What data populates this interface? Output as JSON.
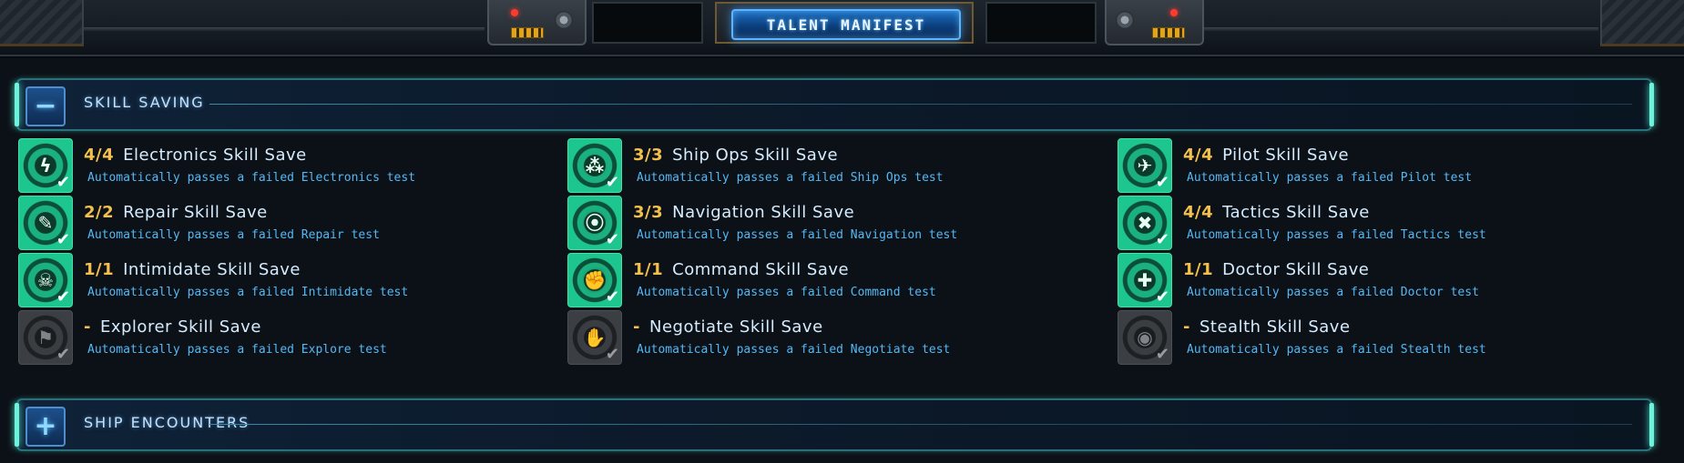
{
  "header": {
    "title": "TALENT MANIFEST"
  },
  "sections": [
    {
      "title": "SKILL SAVING",
      "toggle": "−",
      "expanded": true
    },
    {
      "title": "SHIP ENCOUNTERS",
      "toggle": "+",
      "expanded": false
    }
  ],
  "skills": [
    {
      "count": "4/4",
      "name": "Electronics Skill Save",
      "desc": "Automatically passes a failed Electronics test",
      "icon": "electronics-icon",
      "glyph": "ϟ",
      "unlocked": true
    },
    {
      "count": "2/2",
      "name": "Repair Skill Save",
      "desc": "Automatically passes a failed Repair test",
      "icon": "wrench-icon",
      "glyph": "✎",
      "unlocked": true
    },
    {
      "count": "1/1",
      "name": "Intimidate Skill Save",
      "desc": "Automatically passes a failed Intimidate test",
      "icon": "intimidate-icon",
      "glyph": "☠",
      "unlocked": true
    },
    {
      "count": "-",
      "name": "Explorer Skill Save",
      "desc": "Automatically passes a failed Explore test",
      "icon": "flag-icon",
      "glyph": "⚑",
      "unlocked": false
    },
    {
      "count": "3/3",
      "name": "Ship Ops Skill Save",
      "desc": "Automatically passes a failed Ship Ops test",
      "icon": "ship-ops-icon",
      "glyph": "⁂",
      "unlocked": true
    },
    {
      "count": "3/3",
      "name": "Navigation Skill Save",
      "desc": "Automatically passes a failed Navigation test",
      "icon": "navigation-icon",
      "glyph": "⦿",
      "unlocked": true
    },
    {
      "count": "1/1",
      "name": "Command Skill Save",
      "desc": "Automatically passes a failed Command test",
      "icon": "fist-icon",
      "glyph": "✊",
      "unlocked": true
    },
    {
      "count": "-",
      "name": "Negotiate Skill Save",
      "desc": "Automatically passes a failed Negotiate test",
      "icon": "handshake-icon",
      "glyph": "✋",
      "unlocked": false
    },
    {
      "count": "4/4",
      "name": "Pilot Skill Save",
      "desc": "Automatically passes a failed Pilot test",
      "icon": "pilot-icon",
      "glyph": "✈",
      "unlocked": true
    },
    {
      "count": "4/4",
      "name": "Tactics Skill Save",
      "desc": "Automatically passes a failed Tactics test",
      "icon": "tactics-icon",
      "glyph": "✖",
      "unlocked": true
    },
    {
      "count": "1/1",
      "name": "Doctor Skill Save",
      "desc": "Automatically passes a failed Doctor test",
      "icon": "medical-cross-icon",
      "glyph": "✚",
      "unlocked": true
    },
    {
      "count": "-",
      "name": "Stealth Skill Save",
      "desc": "Automatically passes a failed Stealth test",
      "icon": "stealth-icon",
      "glyph": "◉",
      "unlocked": false
    }
  ],
  "colors": {
    "count": "#f4c04c",
    "desc": "#54b8f4",
    "active_icon": "#1ec68f",
    "accent": "#6ff2dc"
  }
}
